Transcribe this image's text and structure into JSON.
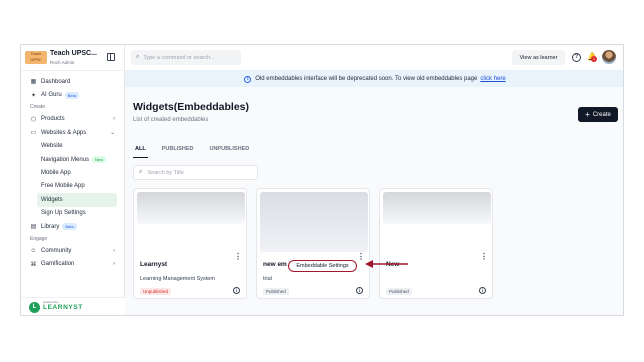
{
  "brand": {
    "logo_text": "Teach UPSC",
    "title": "Teach UPSC...",
    "subtitle": "Roch Admin"
  },
  "sidebar": {
    "items": [
      {
        "label": "Dashboard",
        "icon": "dashboard-icon"
      },
      {
        "label": "AI Guru",
        "icon": "sparkle-icon",
        "badge": "Beta"
      }
    ],
    "section_create": "Create",
    "create_items": [
      {
        "label": "Products",
        "icon": "box-icon"
      },
      {
        "label": "Websites & Apps",
        "icon": "monitor-icon"
      }
    ],
    "sub_items": [
      {
        "label": "Website"
      },
      {
        "label": "Navigation Menus",
        "badge": "New"
      },
      {
        "label": "Mobile App"
      },
      {
        "label": "Free Mobile App"
      },
      {
        "label": "Widgets"
      },
      {
        "label": "Sign Up Settings"
      }
    ],
    "library": {
      "label": "Library",
      "badge": "Beta"
    },
    "section_engage": "Engage",
    "engage_items": [
      {
        "label": "Community",
        "icon": "community-icon"
      },
      {
        "label": "Gamification",
        "icon": "gamepad-icon"
      }
    ],
    "footer_pre": "powered by",
    "footer_logo": "LEARNYST"
  },
  "topbar": {
    "search_placeholder": "Type a command or search...",
    "view_as_learner": "View as learner",
    "notification_count": "1"
  },
  "banner": {
    "text": "Old embeddables interface will be deprecated soon. To view old embeddables page",
    "link": "click here"
  },
  "main": {
    "title": "Widgets(Embeddables)",
    "subtitle": "List of created embeddables",
    "create_label": "Create",
    "tabs": [
      "ALL",
      "PUBLISHED",
      "UNPUBLISHED"
    ],
    "search_placeholder": "Search by Title",
    "cards": [
      {
        "title": "Learnyst",
        "description": "Learning Management System",
        "status": "Unpublished"
      },
      {
        "title": "new em",
        "description": "trial",
        "status": "Published",
        "menu_item": "Embeddable Settings"
      },
      {
        "title": "New",
        "description": "",
        "status": "Published"
      }
    ]
  },
  "colors": {
    "accent": "#111827",
    "brand_green": "#1f9e5a",
    "annotation_red": "#a0182d",
    "banner_bg": "#e8f3fb"
  }
}
